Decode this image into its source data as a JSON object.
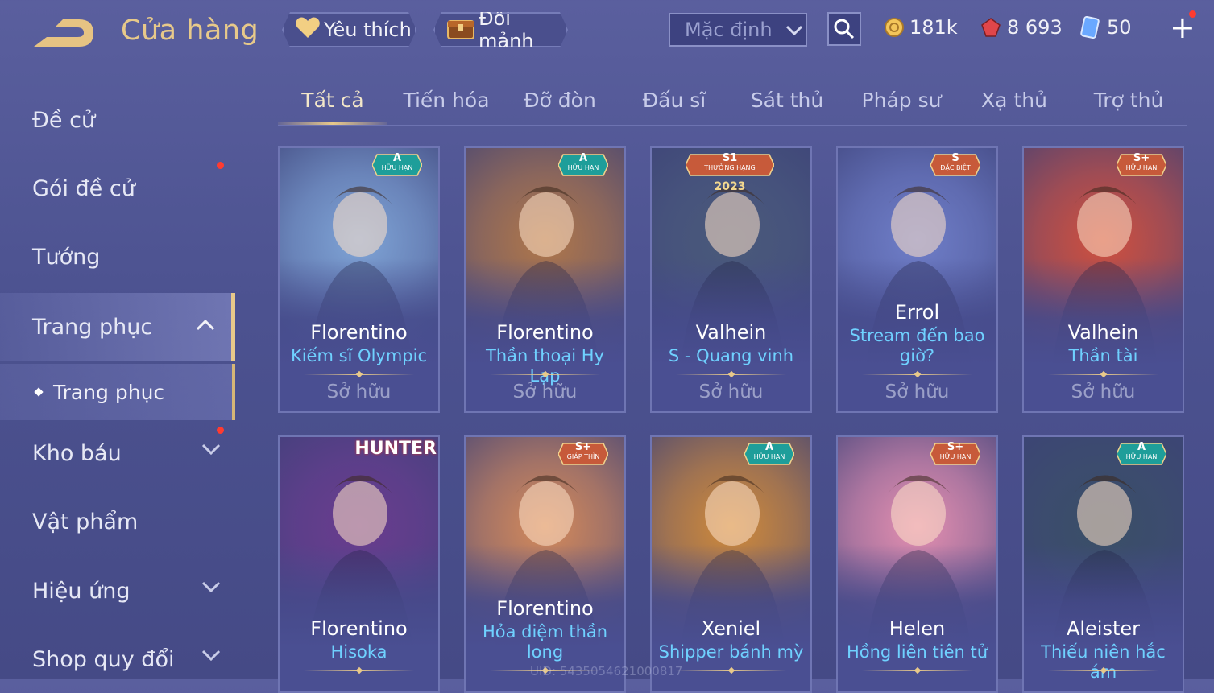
{
  "header": {
    "title": "Cửa hàng",
    "favorites_label": "Yêu thích",
    "exchange_label": "Đổi mảnh",
    "sort_value": "Mặc định",
    "currencies": {
      "gold": "181k",
      "ruby": "8 693",
      "voucher": "50"
    }
  },
  "sidebar": {
    "items": [
      {
        "label": "Đề cử"
      },
      {
        "label": "Gói đề cử"
      },
      {
        "label": "Tướng"
      },
      {
        "label": "Trang phục"
      },
      {
        "label": "Kho báu"
      },
      {
        "label": "Vật phẩm"
      },
      {
        "label": "Hiệu ứng"
      },
      {
        "label": "Shop quy đổi"
      }
    ],
    "sub_item": "Trang phục"
  },
  "tabs": [
    "Tất cả",
    "Tiến hóa",
    "Đỡ đòn",
    "Đấu sĩ",
    "Sát thủ",
    "Pháp sư",
    "Xạ thủ",
    "Trợ thủ"
  ],
  "active_tab": "Tất cả",
  "cards": [
    {
      "hero": "Florentino",
      "skin": "Kiếm sĩ Olympic",
      "status": "Sở hữu",
      "badge_tier": "A",
      "badge_label": "HỮU HẠN",
      "color": "#7fa4d6"
    },
    {
      "hero": "Florentino",
      "skin": "Thần thoại Hy Lạp",
      "status": "Sở hữu",
      "badge_tier": "A",
      "badge_label": "HỮU HẠN",
      "color": "#b0774a"
    },
    {
      "hero": "Valhein",
      "skin": "S - Quang vinh",
      "status": "Sở hữu",
      "badge_tier": "S1",
      "badge_label": "THƯỞNG HẠNG",
      "badge_year": "2023",
      "color": "#4a5a7a"
    },
    {
      "hero": "Errol",
      "skin": "Stream đến bao giờ?",
      "status": "Sở hữu",
      "badge_tier": "S",
      "badge_label": "ĐẶC BIỆT",
      "color": "#6f7ec8"
    },
    {
      "hero": "Valhein",
      "skin": "Thần tài",
      "status": "Sở hữu",
      "badge_tier": "S+",
      "badge_label": "HỮU HẠN",
      "color": "#d0503e"
    },
    {
      "hero": "Florentino",
      "skin": "Hisoka",
      "status": "",
      "badge_tier": "HUNTER",
      "badge_label": "HUNTER",
      "color": "#6a3c8e"
    },
    {
      "hero": "Florentino",
      "skin": "Hỏa diệm thần long",
      "status": "",
      "badge_tier": "S+",
      "badge_label": "GIÁP THÌN",
      "color": "#d58a5a"
    },
    {
      "hero": "Xeniel",
      "skin": "Shipper bánh mỳ",
      "status": "",
      "badge_tier": "A",
      "badge_label": "HỮU HẠN",
      "color": "#d08a3a"
    },
    {
      "hero": "Helen",
      "skin": "Hồng liên tiên tử",
      "status": "",
      "badge_tier": "S+",
      "badge_label": "HỮU HẠN",
      "color": "#e48fb0"
    },
    {
      "hero": "Aleister",
      "skin": "Thiếu niên hắc ám",
      "status": "",
      "badge_tier": "A",
      "badge_label": "HỮU HẠN",
      "color": "#3a4f66"
    }
  ],
  "uid_text": "UID: 5435054621000817",
  "colors": {
    "accent_gold": "#e8c98a",
    "skin_name_blue": "#6fd1ff",
    "notification_red": "#ff3b30"
  }
}
